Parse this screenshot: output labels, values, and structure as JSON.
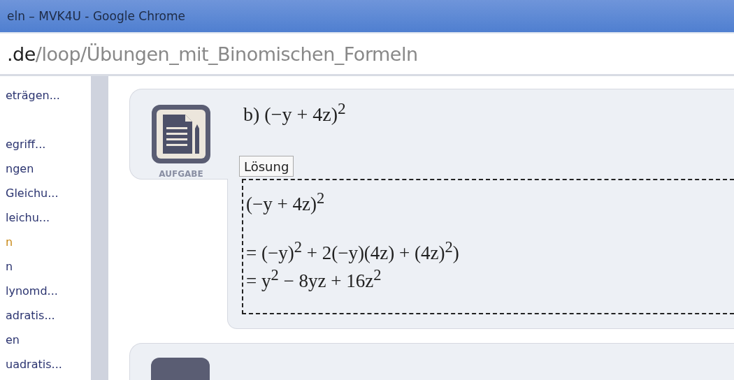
{
  "window": {
    "title": "eln – MVK4U - Google Chrome"
  },
  "address_bar": {
    "host": ".de",
    "path": "/loop/Übungen_mit_Binomischen_Formeln"
  },
  "sidebar": {
    "items": [
      {
        "label": "eträgen...",
        "color": "#2b3470"
      },
      {
        "label": "egriff...",
        "color": "#2b3470"
      },
      {
        "label": "ngen",
        "color": "#2b3470"
      },
      {
        "label": "Gleichu...",
        "color": "#2b3470"
      },
      {
        "label": "leichu...",
        "color": "#2b3470"
      },
      {
        "label": "n",
        "color": "#c98a1a"
      },
      {
        "label": "n",
        "color": "#2b3470"
      },
      {
        "label": "lynomd...",
        "color": "#2b3470"
      },
      {
        "label": "adratis...",
        "color": "#2b3470"
      },
      {
        "label": "en",
        "color": "#2b3470"
      },
      {
        "label": "uadratis...",
        "color": "#2b3470"
      }
    ]
  },
  "task": {
    "badge": "AUFGABE",
    "title": "b) (−y + 4z)$^{2}$",
    "solution_tab": "Lösung",
    "solution_lines": [
      "(−y + 4z)$^{2}$",
      "= (−y)$^{2}$ + 2(−y)(4z) + (4z)$^{2}$)",
      "= y$^{2}$ − 8yz + 16z$^{2}$"
    ]
  }
}
